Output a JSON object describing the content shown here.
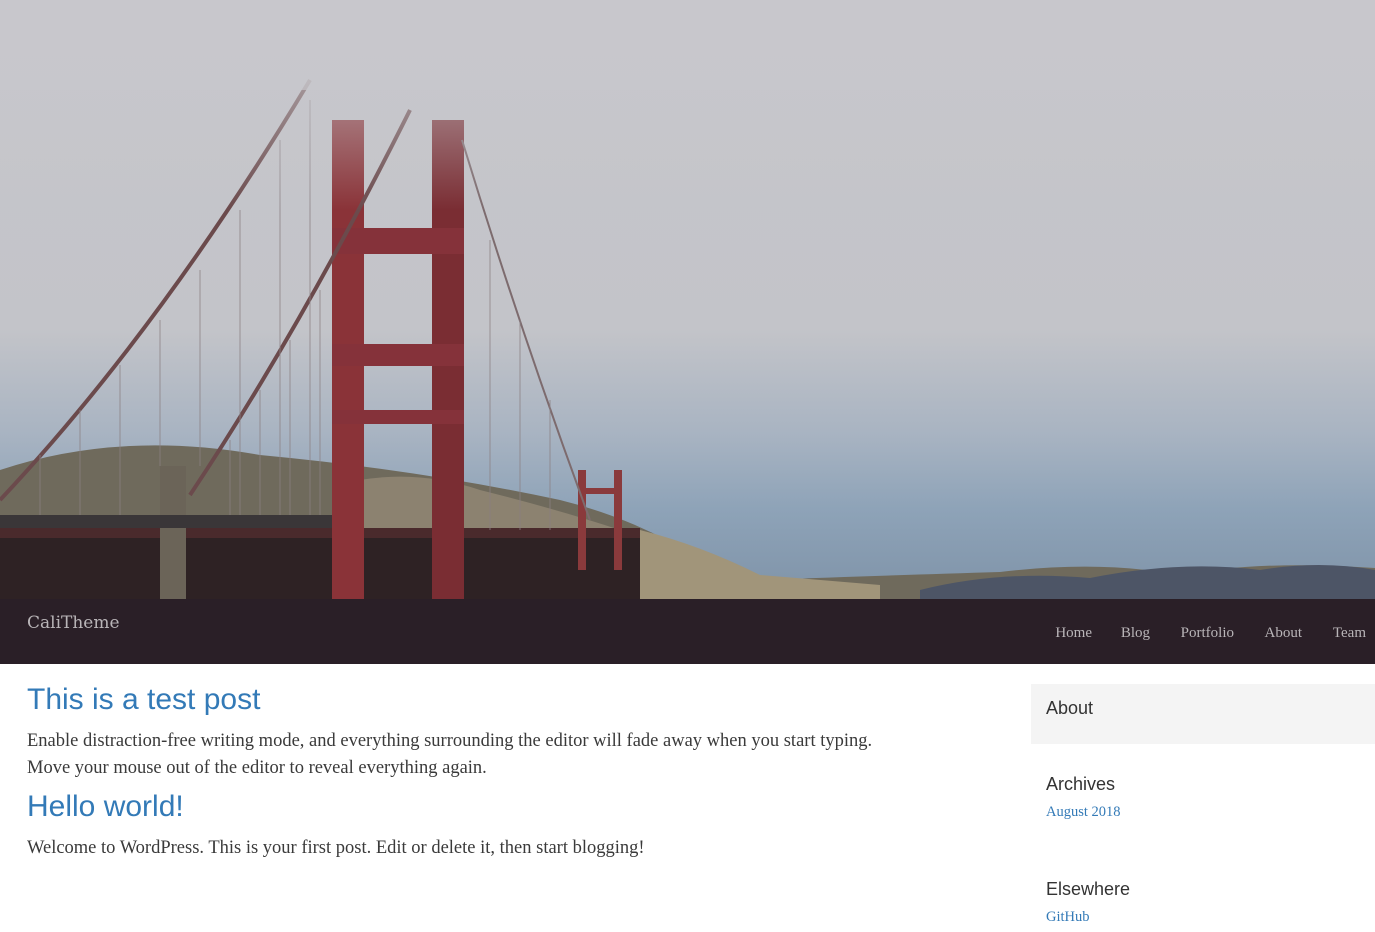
{
  "site": {
    "brand": "CaliTheme"
  },
  "nav": {
    "items": [
      {
        "label": "Home"
      },
      {
        "label": "Blog"
      },
      {
        "label": "Portfolio"
      },
      {
        "label": "About"
      },
      {
        "label": "Team"
      }
    ]
  },
  "posts": [
    {
      "title": "This is a test post",
      "excerpt": "Enable distraction-free writing mode, and everything surrounding the editor will fade away when you start typing. Move your mouse out of the editor to reveal everything again."
    },
    {
      "title": "Hello world!",
      "excerpt": "Welcome to WordPress. This is your first post. Edit or delete it, then start blogging!"
    }
  ],
  "sidebar": {
    "about": {
      "heading": "About"
    },
    "archives": {
      "heading": "Archives",
      "links": [
        {
          "label": "August 2018"
        }
      ]
    },
    "elsewhere": {
      "heading": "Elsewhere",
      "links": [
        {
          "label": "GitHub"
        }
      ]
    }
  },
  "colors": {
    "navbar": "#2a1f27",
    "link": "#337ab7",
    "nav_text": "#b9b5b8",
    "sidebar_box": "#f4f4f4"
  },
  "icons": {
    "hero": "golden-gate-bridge-in-fog-image"
  }
}
